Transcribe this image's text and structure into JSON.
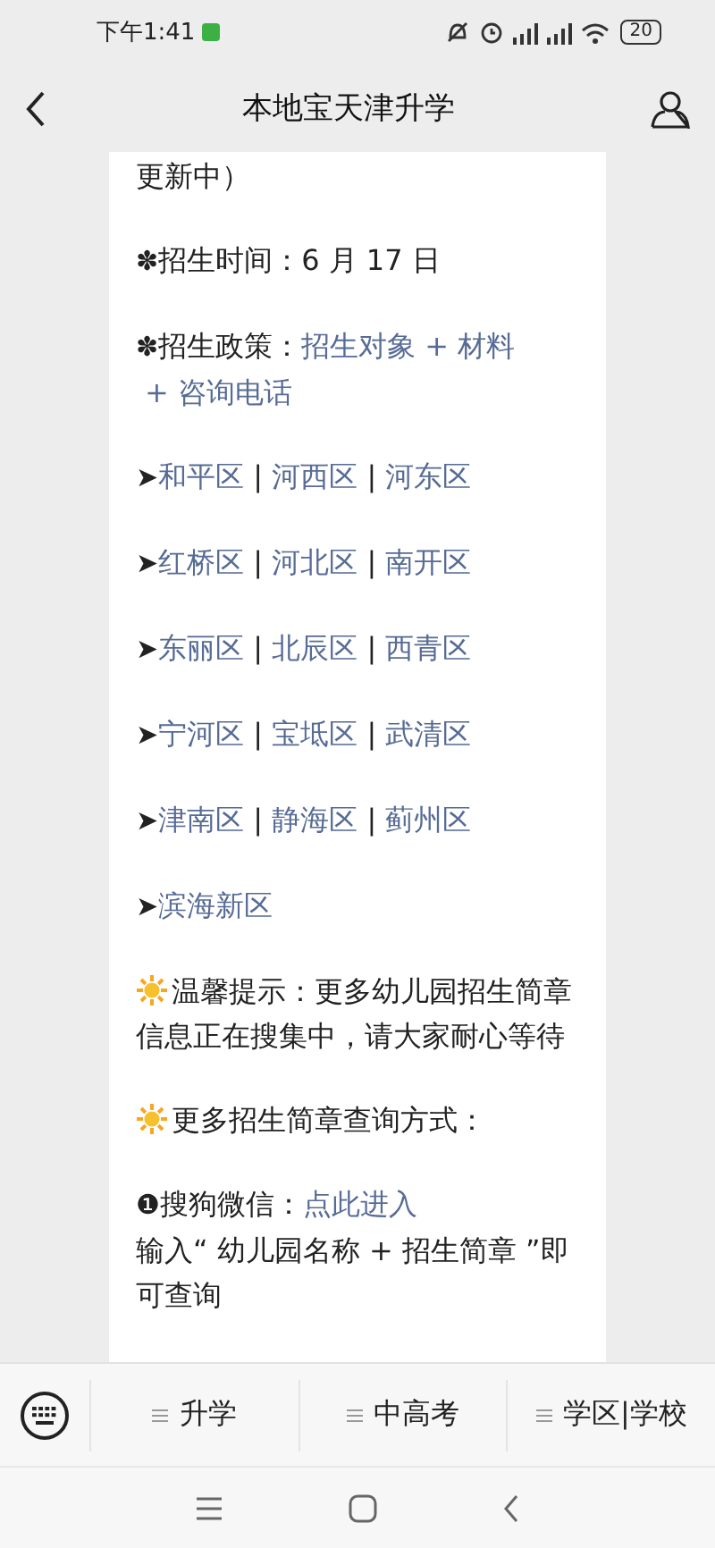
{
  "status_bar": {
    "time": "下午1:41",
    "battery": "20"
  },
  "header": {
    "title": "本地宝天津升学"
  },
  "article": [
    {
      "kind": "text",
      "segments": [
        {
          "text": "更新中）",
          "link": false
        }
      ]
    },
    {
      "kind": "bullet",
      "mark": "✽",
      "segments": [
        {
          "text": "招生时间：6 月 17 日",
          "link": false
        }
      ]
    },
    {
      "kind": "bullet",
      "mark": "✽",
      "segments": [
        {
          "text": "招生政策：",
          "link": false
        },
        {
          "text": "招生对象 + 材料",
          "link": true
        },
        {
          "text": "+ 咨询电话",
          "link": true
        }
      ]
    },
    {
      "kind": "bullet",
      "mark": "➤",
      "segments": [
        {
          "text": "和平区",
          "link": true
        },
        {
          "text": " | ",
          "link": false
        },
        {
          "text": "河西区",
          "link": true
        },
        {
          "text": " | ",
          "link": false
        },
        {
          "text": "河东区",
          "link": true
        }
      ]
    },
    {
      "kind": "bullet",
      "mark": "➤",
      "segments": [
        {
          "text": "红桥区",
          "link": true
        },
        {
          "text": " | ",
          "link": false
        },
        {
          "text": "河北区",
          "link": true
        },
        {
          "text": " | ",
          "link": false
        },
        {
          "text": "南开区",
          "link": true
        }
      ]
    },
    {
      "kind": "bullet",
      "mark": "➤",
      "segments": [
        {
          "text": "东丽区",
          "link": true
        },
        {
          "text": " | ",
          "link": false
        },
        {
          "text": "北辰区",
          "link": true
        },
        {
          "text": " | ",
          "link": false
        },
        {
          "text": "西青区",
          "link": true
        }
      ]
    },
    {
      "kind": "bullet",
      "mark": "➤",
      "segments": [
        {
          "text": "宁河区",
          "link": true
        },
        {
          "text": " | ",
          "link": false
        },
        {
          "text": "宝坻区",
          "link": true
        },
        {
          "text": " | ",
          "link": false
        },
        {
          "text": "武清区",
          "link": true
        }
      ]
    },
    {
      "kind": "bullet",
      "mark": "➤",
      "segments": [
        {
          "text": "津南区",
          "link": true
        },
        {
          "text": " | ",
          "link": false
        },
        {
          "text": "静海区",
          "link": true
        },
        {
          "text": " | ",
          "link": false
        },
        {
          "text": "蓟州区",
          "link": true
        }
      ]
    },
    {
      "kind": "bullet",
      "mark": "➤",
      "segments": [
        {
          "text": "滨海新区",
          "link": true
        }
      ]
    },
    {
      "kind": "sun",
      "segments": [
        {
          "text": "温馨提示：更多幼儿园招生简章信息正在搜集中，请大家耐心等待",
          "link": false
        }
      ]
    },
    {
      "kind": "sun",
      "segments": [
        {
          "text": "更多招生简章查询方式：",
          "link": false
        }
      ]
    },
    {
      "kind": "bullet",
      "mark": "❶",
      "segments": [
        {
          "text": "搜狗微信：",
          "link": false
        },
        {
          "text": "点此进入",
          "link": true
        }
      ]
    },
    {
      "kind": "continuation",
      "segments": [
        {
          "text": "输入“ 幼儿园名称 + 招生简章 ”即可查询",
          "link": false
        }
      ]
    }
  ],
  "menu_bar": {
    "items": [
      {
        "label": "升学"
      },
      {
        "label": "中高考"
      },
      {
        "label": "学区|学校"
      }
    ]
  }
}
